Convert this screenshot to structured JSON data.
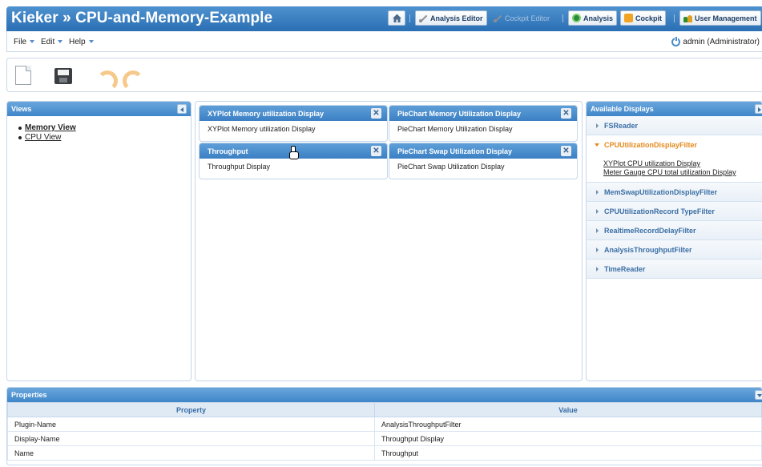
{
  "header": {
    "title": "Kieker » CPU-and-Memory-Example",
    "buttons": {
      "analysis_editor": "Analysis Editor",
      "cockpit_editor": "Cockpit Editor",
      "analysis": "Analysis",
      "cockpit": "Cockpit",
      "user_management": "User Management"
    }
  },
  "menubar": {
    "file": "File",
    "edit": "Edit",
    "help": "Help",
    "user": "admin (Administrator)"
  },
  "views_panel": {
    "title": "Views",
    "items": [
      "Memory View",
      "CPU View"
    ]
  },
  "displays": [
    {
      "header": "XYPlot Memory utilization Display",
      "body": "XYPlot Memory utilization Display"
    },
    {
      "header": "PieChart Memory Utilization Display",
      "body": "PieChart Memory Utilization Display"
    },
    {
      "header": "Throughput",
      "body": "Throughput Display"
    },
    {
      "header": "PieChart Swap Utilization Display",
      "body": "PieChart Swap Utilization Display"
    }
  ],
  "available_displays": {
    "title": "Available Displays",
    "items": [
      "FSReader",
      "CPUUtilizationDisplayFilter",
      "MemSwapUtilizationDisplayFilter",
      "CPUUtilizationRecord TypeFilter",
      "RealtimeRecordDelayFilter",
      "AnalysisThroughputFilter",
      "TimeReader"
    ],
    "open_links": [
      "XYPlot CPU utilization Display",
      "Meter Gauge CPU total utilization Display"
    ]
  },
  "properties": {
    "title": "Properties",
    "columns": [
      "Property",
      "Value"
    ],
    "rows": [
      [
        "Plugin-Name",
        "AnalysisThroughputFilter"
      ],
      [
        "Display-Name",
        "Throughput Display"
      ],
      [
        "Name",
        "Throughput"
      ]
    ]
  },
  "colors": {
    "header_blue": "#3a80c4",
    "accent_orange": "#e48a1c",
    "link_blue": "#3a6ea5"
  }
}
